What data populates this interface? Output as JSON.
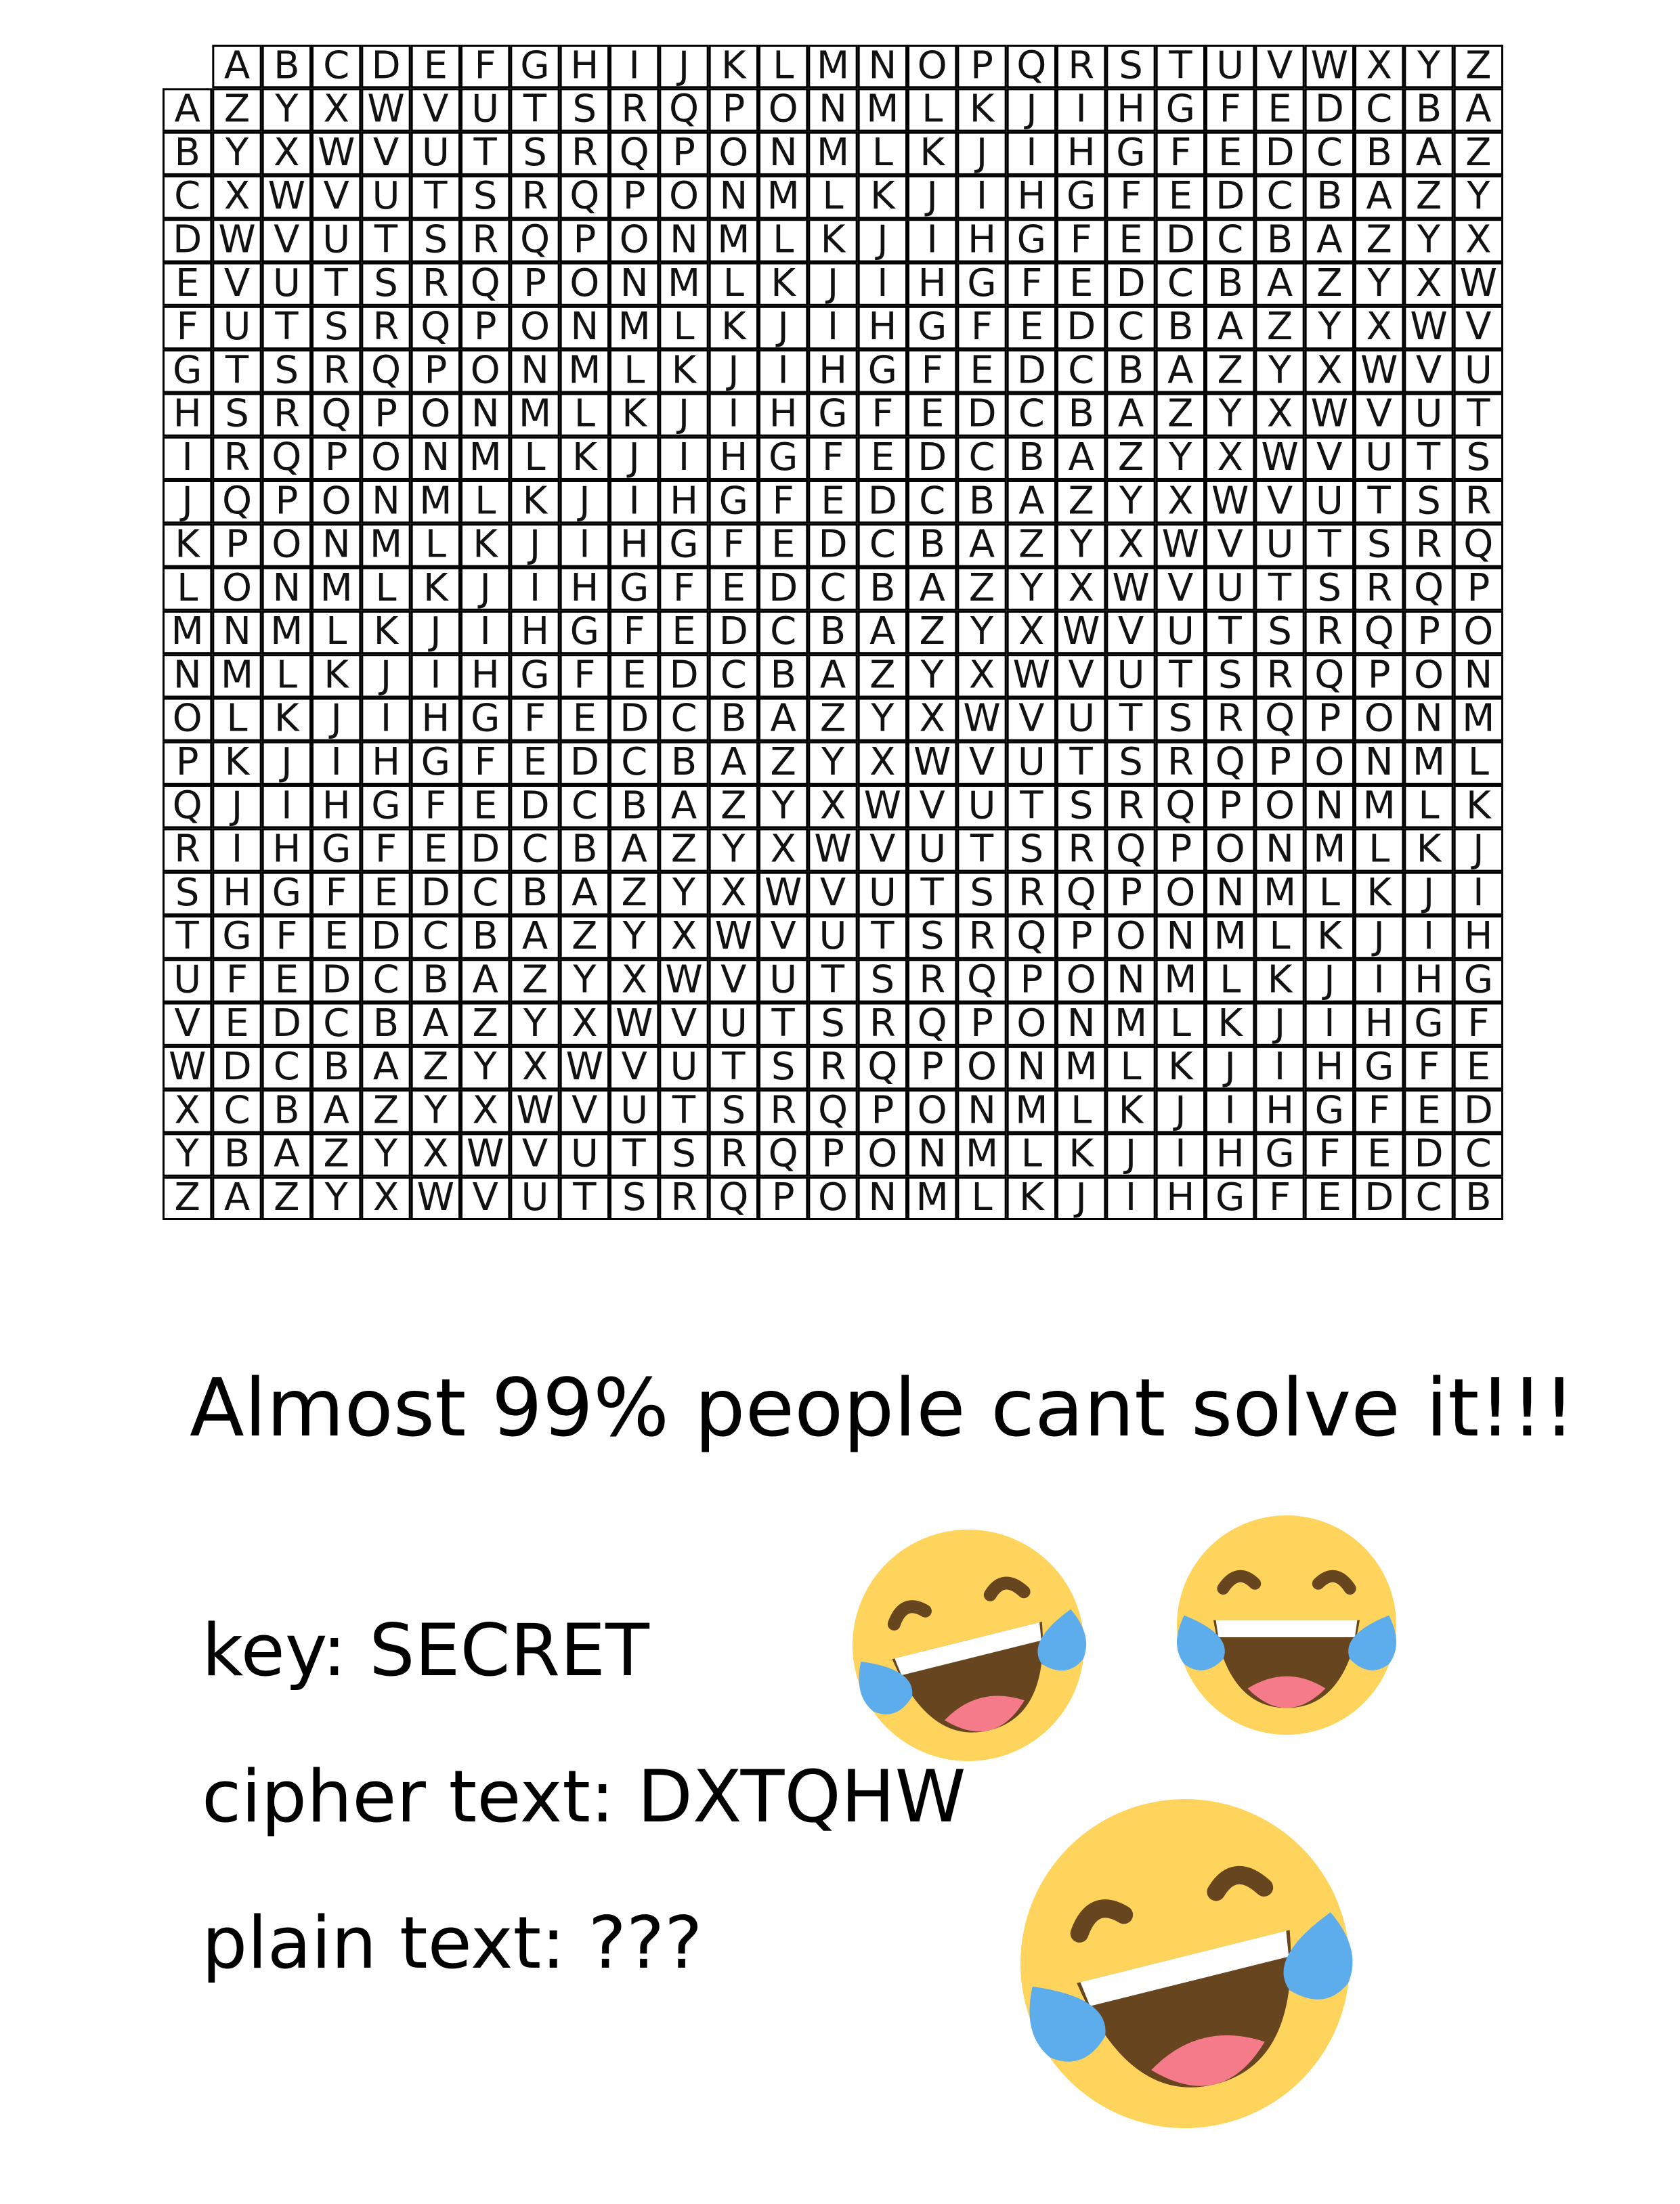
{
  "table": {
    "header_letters": [
      "A",
      "B",
      "C",
      "D",
      "E",
      "F",
      "G",
      "H",
      "I",
      "J",
      "K",
      "L",
      "M",
      "N",
      "O",
      "P",
      "Q",
      "R",
      "S",
      "T",
      "U",
      "V",
      "W",
      "X",
      "Y",
      "Z"
    ],
    "rows": [
      "AZYXWVUTSRQPONMLKJIHGFEDCBA",
      "BYXWVUTSRQPONMLKJIHGFEDCBAZ",
      "CXWVUTSRQPONMLKJIHGFEDCBAZY",
      "DWVUTSRQPONMLKJIHGFEDCBAZYX",
      "EVUTSRQPONMLKJIHGFEDCBAZYXW",
      "FUTSRQPONMLKJIHGFEDCBAZYXWV",
      "GTSRQPONMLKJIHGFEDCBAZYXWVU",
      "HSRQPONMLKJIHGFEDCBAZYXWVUT",
      "IRQPONMLKJIHGFEDCBAZYXWVUTS",
      "JQPONMLKJIHGFEDCBAZYXWVUTSR",
      "KPONMLKJIHGFEDCBAZYXWVUTSRQ",
      "LONMLKJIHGFEDCBAZYXWVUTSRQP",
      "MNMLKJIHGFEDCBAZYXWVUTSRQPO",
      "NMLKJIHGFEDCBAZYXWVUTSRQPON",
      "OLKJIHGFEDCBAZYXWVUTSRQPONM",
      "PKJIHGFEDCBAZYXWVUTSRQPONML",
      "QJIHGFEDCBAZYXWVUTSRQPONMLK",
      "RIHGFEDCBAZYXWVUTSRQPONMLKJ",
      "SHGFEDCBAZYXWVUTSRQPONMLKJI",
      "TGFEDCBAZYXWVUTSRQPONMLKJIH",
      "UFEDCBAZYXWVUTSRQPONMLKJIHG",
      "VEDCBAZYXWVUTSRQPONMLKJIHGF",
      "WDCBAZYXWVUTSRQPONMLKJIHGFE",
      "XCBAZYXWVUTSRQPONMLKJIHGFED",
      "YBAZYXWVUTSRQPONMLKJIHGFEDC",
      "ZAZYXWVUTSRQPONMLKJIHGFEDCB"
    ]
  },
  "headline": "Almost 99% people cant solve it!!!",
  "key_line": "key: SECRET",
  "cipher_line": "cipher text: DXTQHW",
  "plain_line": "plain text: ???",
  "emojis": [
    "laughing-tears-face",
    "laughing-tears-face",
    "laughing-tears-face"
  ],
  "colors": {
    "face": "#FFD45C",
    "tears": "#5DADEC",
    "mouth": "#66451F",
    "tongue": "#F57A8A",
    "grid": "#000000"
  }
}
